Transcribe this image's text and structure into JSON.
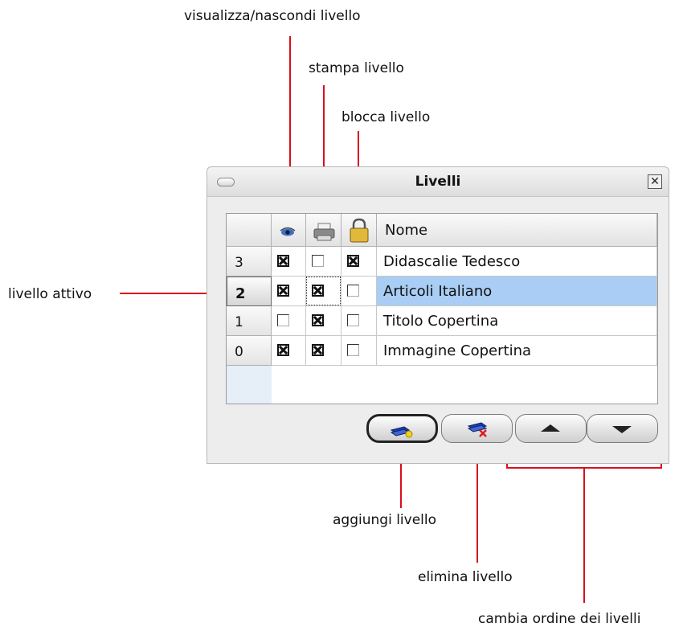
{
  "annotations": {
    "visibility": "visualizza/nascondi livello",
    "print": "stampa livello",
    "lock": "blocca livello",
    "active": "livello attivo",
    "add": "aggiungi livello",
    "delete": "elimina livello",
    "reorder": "cambia ordine dei livelli"
  },
  "window": {
    "title": "Livelli"
  },
  "table": {
    "header_icons": [
      "eye-icon",
      "printer-icon",
      "lock-icon"
    ],
    "name_header": "Nome",
    "rows": [
      {
        "index": "3",
        "visible": true,
        "printable": false,
        "locked": true,
        "name": "Didascalie Tedesco",
        "selected": false
      },
      {
        "index": "2",
        "visible": true,
        "printable": true,
        "locked": false,
        "name": "Articoli Italiano",
        "selected": true
      },
      {
        "index": "1",
        "visible": false,
        "printable": true,
        "locked": false,
        "name": "Titolo Copertina",
        "selected": false
      },
      {
        "index": "0",
        "visible": true,
        "printable": true,
        "locked": false,
        "name": "Immagine Copertina",
        "selected": false
      }
    ]
  },
  "buttons": [
    "add-layer-icon",
    "delete-layer-icon",
    "arrow-up-icon",
    "arrow-down-icon"
  ],
  "colors": {
    "callout_red": "#d90f1c",
    "selection": "#a9cdf4",
    "row_header": "#e6eef8"
  }
}
